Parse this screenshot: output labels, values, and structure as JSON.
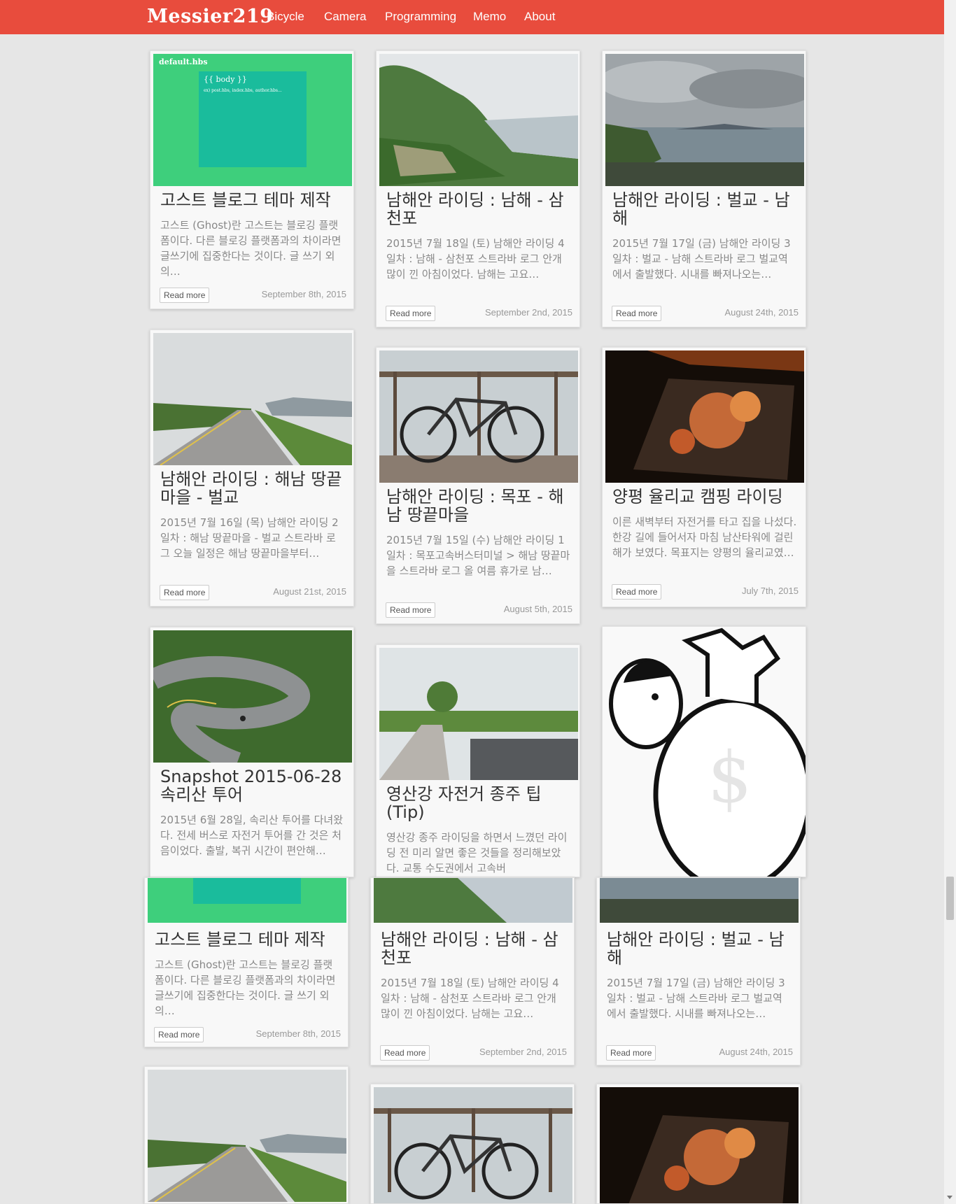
{
  "site": {
    "brand": "Messier219"
  },
  "nav": {
    "items": [
      "Bicycle",
      "Camera",
      "Programming",
      "Memo",
      "About"
    ]
  },
  "posts": [
    {
      "title": "고스트 블로그 테마 제작",
      "excerpt": "고스트 (Ghost)란 고스트는 블로깅 플랫폼이다. 다른 블로깅 플랫폼과의 차이라면 글쓰기에 집중한다는 것이다. 글 쓰기 외의…",
      "read_more": "Read more",
      "date": "September 8th, 2015",
      "image_text": {
        "filename": "default.hbs",
        "body": "{{ body }}",
        "examples": "ex) post.hbs, index.hbs, author.hbs..."
      }
    },
    {
      "title": "남해안 라이딩 : 남해 - 삼천포",
      "excerpt": "2015년 7월 18일 (토) 남해안 라이딩 4일차 : 남해 - 삼천포 스트라바 로그 안개 많이 낀 아침이었다. 남해는 고요…",
      "read_more": "Read more",
      "date": "September 2nd, 2015"
    },
    {
      "title": "남해안 라이딩 : 벌교 - 남해",
      "excerpt": "2015년 7월 17일 (금) 남해안 라이딩 3일차 : 벌교 - 남해 스트라바 로그 벌교역에서 출발했다. 시내를 빠져나오는…",
      "read_more": "Read more",
      "date": "August 24th, 2015"
    },
    {
      "title": "남해안 라이딩 : 해남 땅끝마을 - 벌교",
      "excerpt": "2015년 7월 16일 (목) 남해안 라이딩 2일차 : 해남 땅끝마을 - 벌교 스트라바 로그 오늘 일정은 해남 땅끝마을부터…",
      "read_more": "Read more",
      "date": "August 21st, 2015"
    },
    {
      "title": "남해안 라이딩 : 목포 - 해남 땅끝마을",
      "excerpt": "2015년 7월 15일 (수) 남해안 라이딩 1일차 : 목포고속버스터미널 > 해남 땅끝마을 스트라바 로그 올 여름 휴가로 남…",
      "read_more": "Read more",
      "date": "August 5th, 2015"
    },
    {
      "title": "양평 율리교 캠핑 라이딩",
      "excerpt": "이른 새벽부터 자전거를 타고 집을 나섰다. 한강 길에 들어서자 마침 남산타워에 걸린 해가 보였다. 목표지는 양평의 율리교였…",
      "read_more": "Read more",
      "date": "July 7th, 2015"
    },
    {
      "title": "Snapshot 2015-06-28 속리산 투어",
      "excerpt": "2015년 6월 28일, 속리산 투어를 다녀왔다. 전세 버스로 자전거 투어를 간 것은 처음이었다. 출발, 복귀 시간이 편안해…"
    },
    {
      "title": "영산강 자전거 종주 팁 (Tip)",
      "excerpt": "영산강 종주 라이딩을 하면서 느꼈던 라이딩 전 미리 알면 좋은 것들을 정리해보았다. 교통 수도권에서 고속버"
    }
  ],
  "theme": {
    "accent": "#e84c3d",
    "page_bg": "#e6e6e6",
    "card_bg": "#f8f8f8",
    "ghost_green": "#3ecf7c",
    "ghost_teal": "#1abc9c"
  }
}
